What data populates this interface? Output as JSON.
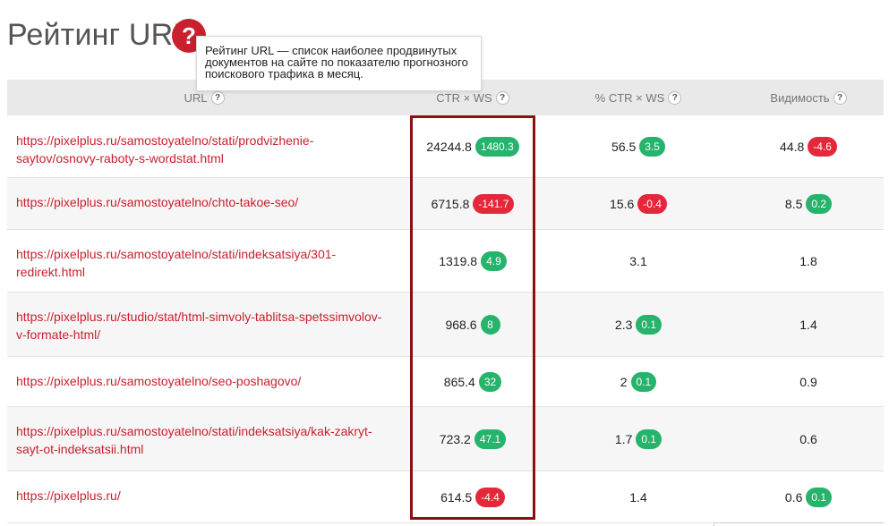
{
  "page": {
    "title": "Рейтинг URL",
    "help_glyph": "?",
    "tooltip": "Рейтинг URL — список наиболее продвинутых документов на сайте по показателю прогнозного поискового трафика в месяц."
  },
  "table": {
    "columns": [
      {
        "label": "URL",
        "help": "?"
      },
      {
        "label": "CTR × WS",
        "help": "?"
      },
      {
        "label": "% CTR × WS",
        "help": "?"
      },
      {
        "label": "Видимость",
        "help": "?"
      }
    ],
    "rows": [
      {
        "url": "https://pixelplus.ru/samostoyatelno/stati/prodvizhenie-saytov/osnovy-raboty-s-wordstat.html",
        "ctr_ws": "24244.8",
        "ctr_ws_delta": "1480.3",
        "ctr_ws_dir": "up",
        "pct": "56.5",
        "pct_delta": "3.5",
        "pct_dir": "up",
        "vis": "44.8",
        "vis_delta": "-4.6",
        "vis_dir": "down"
      },
      {
        "url": "https://pixelplus.ru/samostoyatelno/chto-takoe-seo/",
        "ctr_ws": "6715.8",
        "ctr_ws_delta": "-141.7",
        "ctr_ws_dir": "down",
        "pct": "15.6",
        "pct_delta": "-0.4",
        "pct_dir": "down",
        "vis": "8.5",
        "vis_delta": "0.2",
        "vis_dir": "up"
      },
      {
        "url": "https://pixelplus.ru/samostoyatelno/stati/indeksatsiya/301-redirekt.html",
        "ctr_ws": "1319.8",
        "ctr_ws_delta": "4.9",
        "ctr_ws_dir": "up",
        "pct": "3.1",
        "pct_delta": null,
        "pct_dir": null,
        "vis": "1.8",
        "vis_delta": null,
        "vis_dir": null
      },
      {
        "url": "https://pixelplus.ru/studio/stat/html-simvoly-tablitsa-spetssimvolov-v-formate-html/",
        "ctr_ws": "968.6",
        "ctr_ws_delta": "8",
        "ctr_ws_dir": "up",
        "pct": "2.3",
        "pct_delta": "0.1",
        "pct_dir": "up",
        "vis": "1.4",
        "vis_delta": null,
        "vis_dir": null
      },
      {
        "url": "https://pixelplus.ru/samostoyatelno/seo-poshagovo/",
        "ctr_ws": "865.4",
        "ctr_ws_delta": "32",
        "ctr_ws_dir": "up",
        "pct": "2",
        "pct_delta": "0.1",
        "pct_dir": "up",
        "vis": "0.9",
        "vis_delta": null,
        "vis_dir": null
      },
      {
        "url": "https://pixelplus.ru/samostoyatelno/stati/indeksatsiya/kak-zakryt-sayt-ot-indeksatsii.html",
        "ctr_ws": "723.2",
        "ctr_ws_delta": "47.1",
        "ctr_ws_dir": "up",
        "pct": "1.7",
        "pct_delta": "0.1",
        "pct_dir": "up",
        "vis": "0.6",
        "vis_delta": null,
        "vis_dir": null
      },
      {
        "url": "https://pixelplus.ru/",
        "ctr_ws": "614.5",
        "ctr_ws_delta": "-4.4",
        "ctr_ws_dir": "down",
        "pct": "1.4",
        "pct_delta": null,
        "pct_dir": null,
        "vis": "0.6",
        "vis_delta": "0.1",
        "vis_dir": "up"
      }
    ]
  },
  "colors": {
    "accent": "#c8202e",
    "positive": "#26b36b",
    "negative": "#e4283a",
    "highlight_border": "#8b1010"
  }
}
